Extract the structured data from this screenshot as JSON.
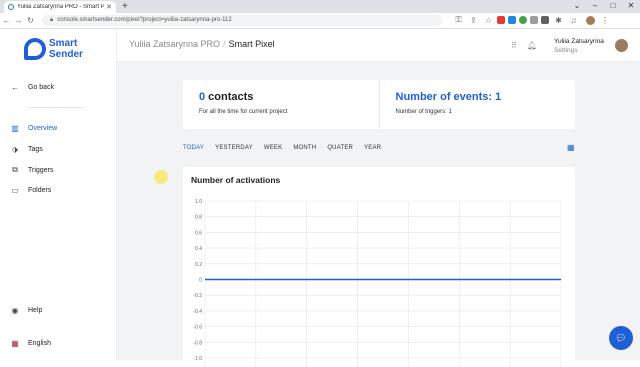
{
  "browser": {
    "tab_title": "Yuliia Zatsarynna PRO - Smart P...",
    "new_tab": "+",
    "url": "console.smartsender.com/pixel?project=yuliia-zatsarynna-pro-112"
  },
  "sidebar": {
    "logo_line1": "Smart",
    "logo_line2": "Sender",
    "back": "Go back",
    "items": [
      {
        "label": "Overview",
        "icon": "overview-icon"
      },
      {
        "label": "Tags",
        "icon": "tag-icon"
      },
      {
        "label": "Triggers",
        "icon": "triggers-icon"
      },
      {
        "label": "Folders",
        "icon": "folder-icon"
      }
    ],
    "help": "Help",
    "language": "English"
  },
  "header": {
    "project": "Yuliia Zatsarynna PRO",
    "page": "Smart Pixel",
    "user_name": "Yuliia Zatsarynna",
    "user_sub": "Settings"
  },
  "stats": {
    "contacts_num": "0",
    "contacts_word": " contacts",
    "contacts_sub": "For all the time for current project",
    "events": "Number of events: 1",
    "triggers": "Number of triggers: 1"
  },
  "periods": [
    "TODAY",
    "YESTERDAY",
    "WEEK",
    "MONTH",
    "QUATER",
    "YEAR"
  ],
  "chart_title": "Number of activations",
  "chart_data": {
    "type": "line",
    "title": "Number of activations",
    "ylim": [
      -1.0,
      1.0
    ],
    "yticks": [
      "1.0",
      "0.8",
      "0.6",
      "0.4",
      "0.2",
      "0",
      "-0.2",
      "-0.4",
      "-0.6",
      "-0.8",
      "-1.0"
    ],
    "series": [
      {
        "values": [
          0,
          0,
          0,
          0,
          0,
          0,
          0
        ]
      }
    ],
    "grid": true
  },
  "colors": {
    "accent": "#1f5fd6"
  }
}
